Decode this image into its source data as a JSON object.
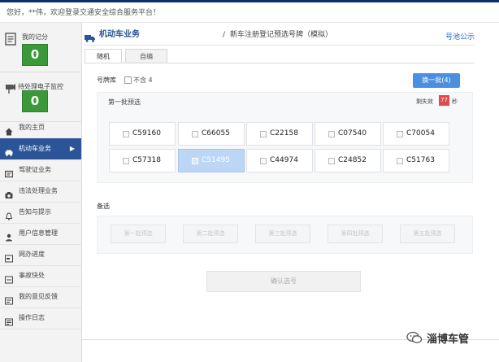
{
  "header": {
    "welcome": "您好，**伟，欢迎登录交通安全综合服务平台！"
  },
  "sidebar": {
    "my_record": {
      "label": "我的记分",
      "value": "0"
    },
    "monitor": {
      "label": "待处理电子监控",
      "value": "0"
    },
    "items": [
      {
        "label": "我的主页",
        "icon": "home-icon"
      },
      {
        "label": "机动车业务",
        "icon": "car-icon",
        "active": true
      },
      {
        "label": "驾驶证业务",
        "icon": "id-card-icon"
      },
      {
        "label": "违法处理业务",
        "icon": "camera-icon"
      },
      {
        "label": "告知与提示",
        "icon": "bell-icon"
      },
      {
        "label": "用户信息管理",
        "icon": "user-icon"
      },
      {
        "label": "网办进度",
        "icon": "progress-icon"
      },
      {
        "label": "事故快处",
        "icon": "accident-icon"
      },
      {
        "label": "我的意见反馈",
        "icon": "feedback-icon"
      },
      {
        "label": "操作日志",
        "icon": "log-icon"
      }
    ]
  },
  "main": {
    "title": "机动车业务",
    "separator": "/",
    "subtitle": "新车注册登记预选号牌（模拟）",
    "announce_link": "号池公示",
    "tabs": [
      {
        "label": "随机",
        "active": true
      },
      {
        "label": "自编",
        "active": false
      }
    ],
    "pool_label": "号牌库",
    "pool_exclude": "不含 4",
    "change_button": "换一批(4)",
    "batch_label": "第一批预选",
    "countdown_label": "剩失效",
    "countdown_value": "77",
    "countdown_unit": "秒",
    "plates": [
      {
        "text": "C59160",
        "selected": false
      },
      {
        "text": "C66055",
        "selected": false
      },
      {
        "text": "C22158",
        "selected": false
      },
      {
        "text": "C07540",
        "selected": false
      },
      {
        "text": "C70054",
        "selected": false
      },
      {
        "text": "C57318",
        "selected": false
      },
      {
        "text": "C51495",
        "selected": true
      },
      {
        "text": "C44974",
        "selected": false
      },
      {
        "text": "C24852",
        "selected": false
      },
      {
        "text": "C51763",
        "selected": false
      }
    ],
    "alternates_label": "备选",
    "alternate_slots": [
      "第一批预选",
      "第二批预选",
      "第三批预选",
      "第四批预选",
      "第五批预选"
    ],
    "confirm_button": "确认选号"
  },
  "watermark": {
    "text": "淄博车管",
    "icon": "wechat-icon"
  },
  "colors": {
    "accent": "#2b5597",
    "button": "#4a8fe0",
    "green": "#3a9a3a",
    "countdown": "#e14a4a",
    "selected_plate": "#bcd7f5"
  }
}
